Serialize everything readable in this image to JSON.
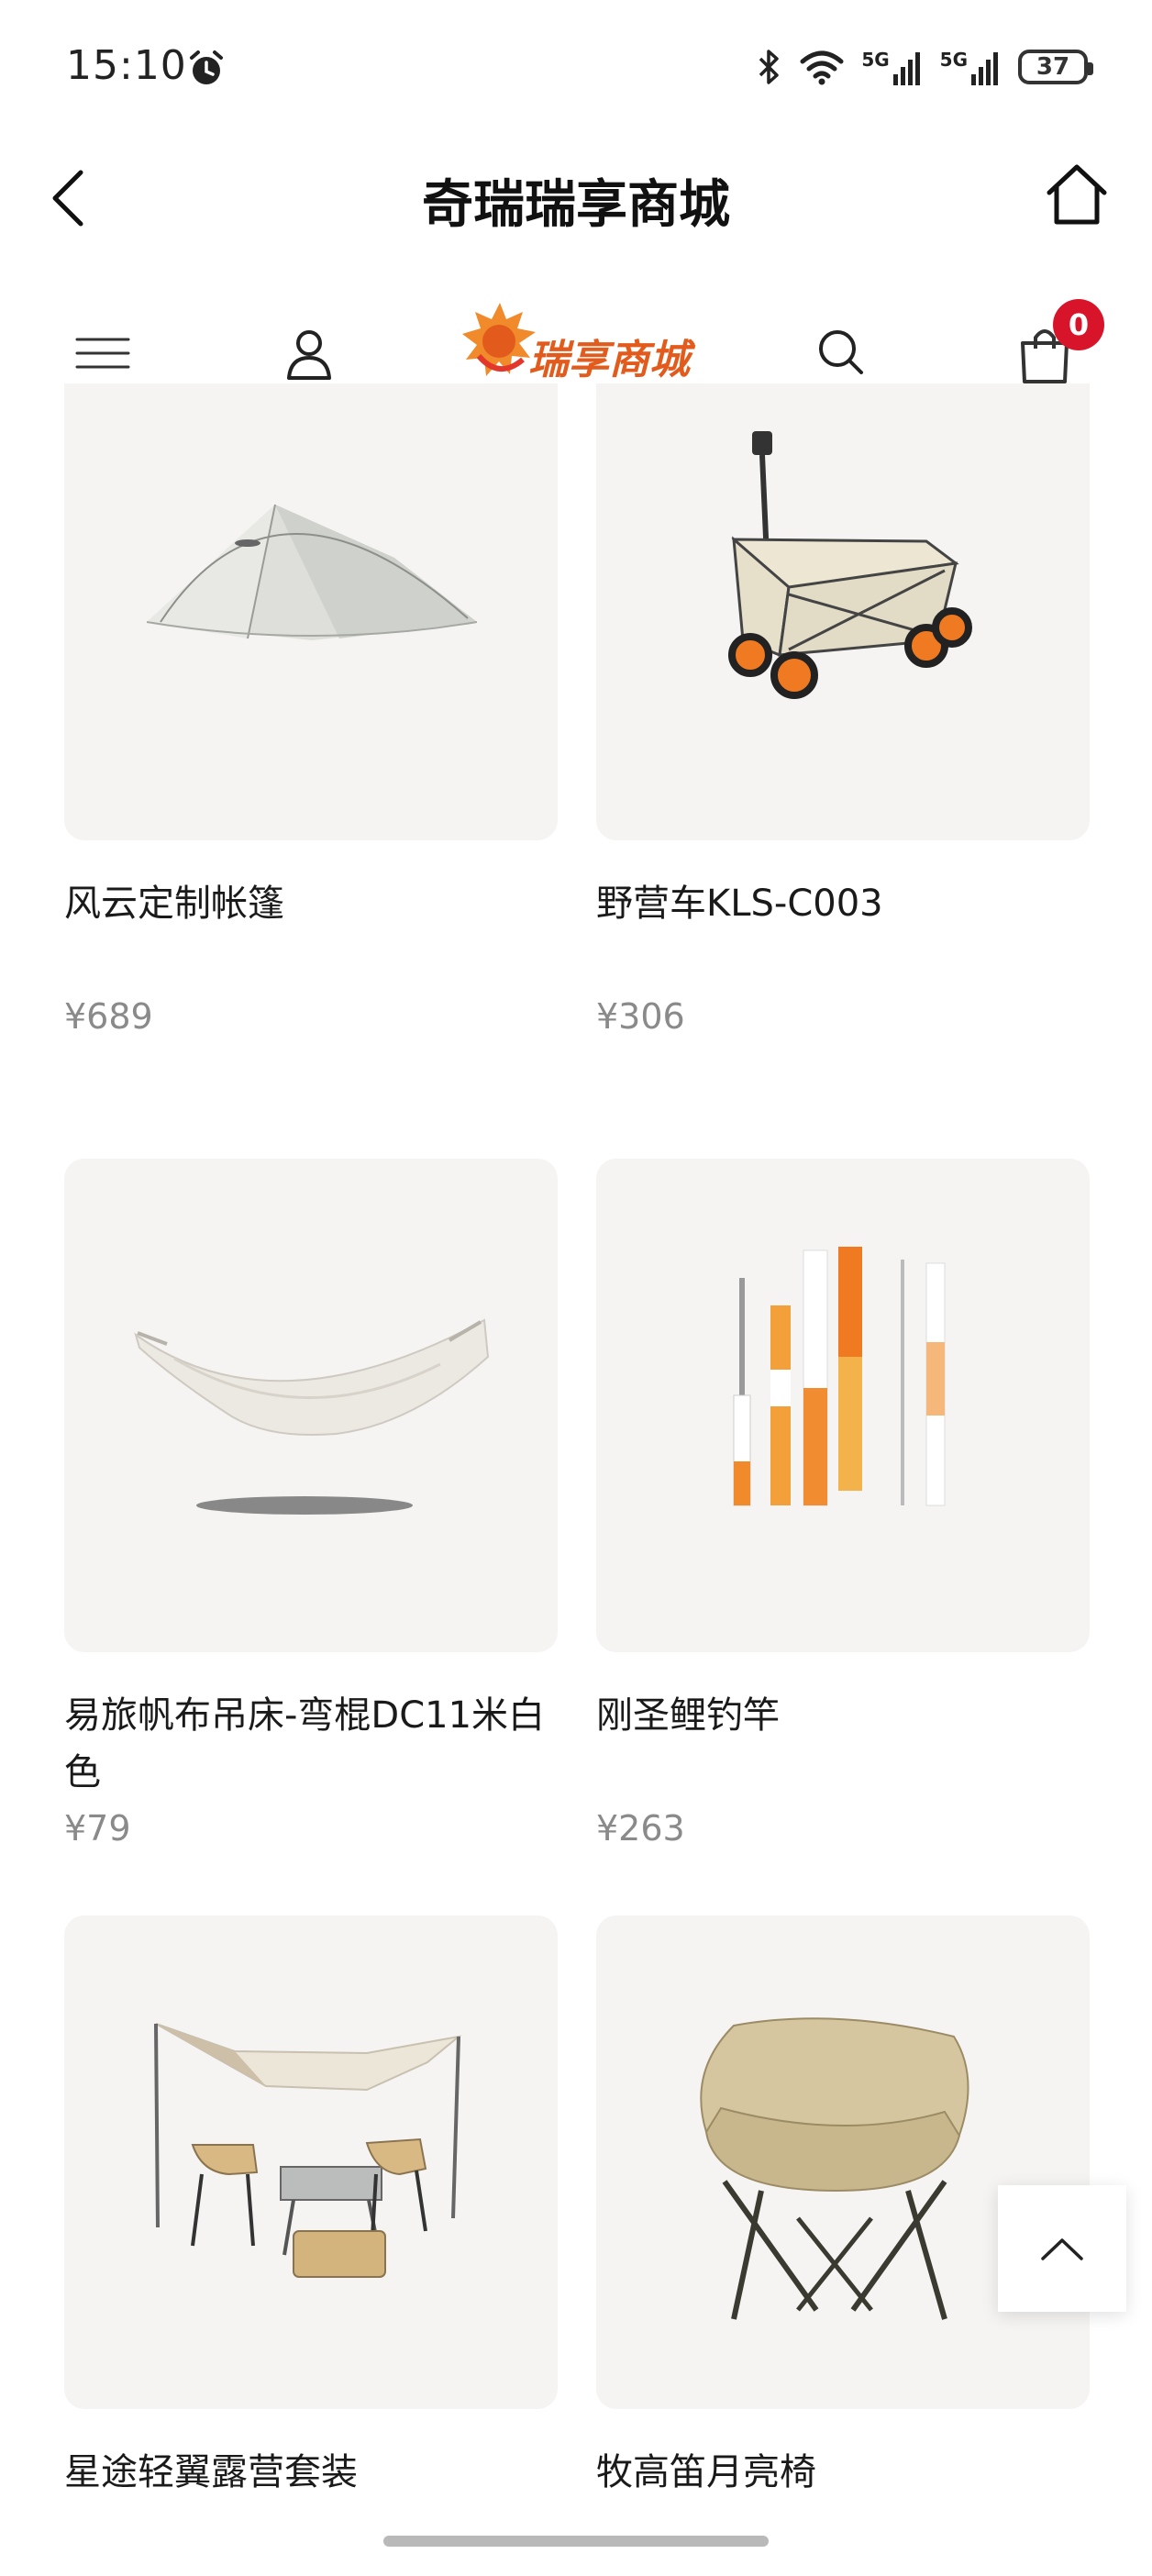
{
  "status_bar": {
    "time": "15:10",
    "network_1": "5G",
    "network_2": "5G",
    "battery": "37"
  },
  "header": {
    "title": "奇瑞瑞享商城"
  },
  "shop_nav": {
    "logo_text": "瑞享商城",
    "cart_count": "0"
  },
  "products": [
    {
      "name": "风云定制帐篷",
      "price": "¥689",
      "icon": "tent-image"
    },
    {
      "name": "野营车KLS-C003",
      "price": "¥306",
      "icon": "camping-wagon-image"
    },
    {
      "name": "易旅帆布吊床-弯棍DC11米白色",
      "price": "¥79",
      "icon": "hammock-image"
    },
    {
      "name": "刚圣鲤钓竿",
      "price": "¥263",
      "icon": "fishing-rod-image"
    },
    {
      "name": "星途轻翼露营套装",
      "price": "",
      "icon": "camping-set-image"
    },
    {
      "name": "牧高笛月亮椅",
      "price": "",
      "icon": "moon-chair-image"
    }
  ],
  "colors": {
    "brand": "#e25a1c",
    "badge": "#d8142a",
    "card_bg": "#f5f4f2",
    "price": "#8a8a8a"
  }
}
